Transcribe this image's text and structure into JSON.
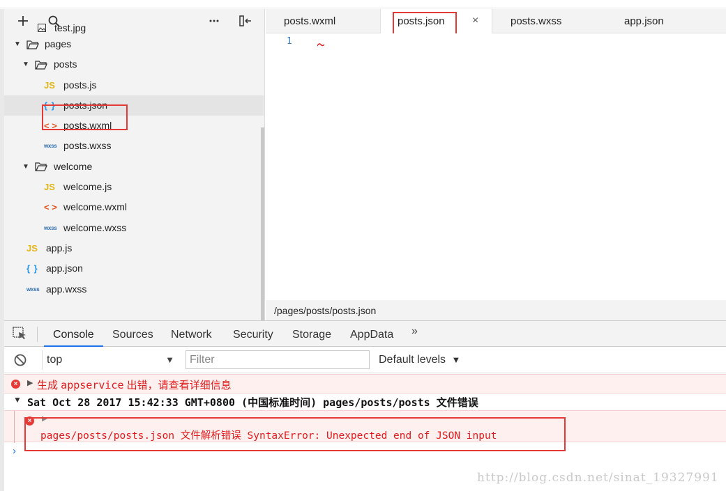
{
  "sidebar": {
    "toolbar": {
      "add_icon": "plus-icon",
      "search_icon": "search-icon",
      "more_icon": "ellipsis-icon",
      "collapse_icon": "collapse-panel-icon"
    },
    "items": [
      {
        "label": "test.jpg",
        "type": "image"
      },
      {
        "label": "pages",
        "type": "folder"
      },
      {
        "label": "posts",
        "type": "folder"
      },
      {
        "label": "posts.js",
        "type": "js"
      },
      {
        "label": "posts.json",
        "type": "json"
      },
      {
        "label": "posts.wxml",
        "type": "wxml"
      },
      {
        "label": "posts.wxss",
        "type": "wxss"
      },
      {
        "label": "welcome",
        "type": "folder"
      },
      {
        "label": "welcome.js",
        "type": "js"
      },
      {
        "label": "welcome.wxml",
        "type": "wxml"
      },
      {
        "label": "welcome.wxss",
        "type": "wxss"
      },
      {
        "label": "app.js",
        "type": "js"
      },
      {
        "label": "app.json",
        "type": "json"
      },
      {
        "label": "app.wxss",
        "type": "wxss"
      }
    ],
    "file_icons": {
      "js": "JS",
      "json": "{ }",
      "wxml": "< >",
      "wxss": "wxss"
    }
  },
  "editor": {
    "tabs": [
      {
        "label": "posts.wxml"
      },
      {
        "label": "posts.json",
        "active": true
      },
      {
        "label": "posts.wxss"
      },
      {
        "label": "app.json"
      }
    ],
    "close_glyph": "×",
    "line_numbers": [
      "1"
    ],
    "status_path": "/pages/posts/posts.json"
  },
  "devtools": {
    "tabs": [
      "Console",
      "Sources",
      "Network",
      "Security",
      "Storage",
      "AppData"
    ],
    "active_tab": "Console",
    "more_glyph": "»",
    "context": "top",
    "filter_placeholder": "Filter",
    "levels": "Default levels",
    "logs": {
      "first_prefix": "生成 ",
      "first_code": "appservice",
      "first_suffix": " 出错，请查看详细信息",
      "group_title": "Sat Oct 28 2017 15:42:33 GMT+0800 (中国标准时间) pages/posts/posts 文件错误",
      "error_detail": "pages/posts/posts.json 文件解析错误  SyntaxError: Unexpected end of JSON input"
    }
  },
  "watermark": "http://blog.csdn.net/sinat_19327991",
  "colors": {
    "accent": "#1a73e8",
    "error": "#e01b1b",
    "highlight_box": "#e53935",
    "js_icon": "#e2b616",
    "json_icon": "#2196f3",
    "wxml_icon": "#e4531f"
  }
}
